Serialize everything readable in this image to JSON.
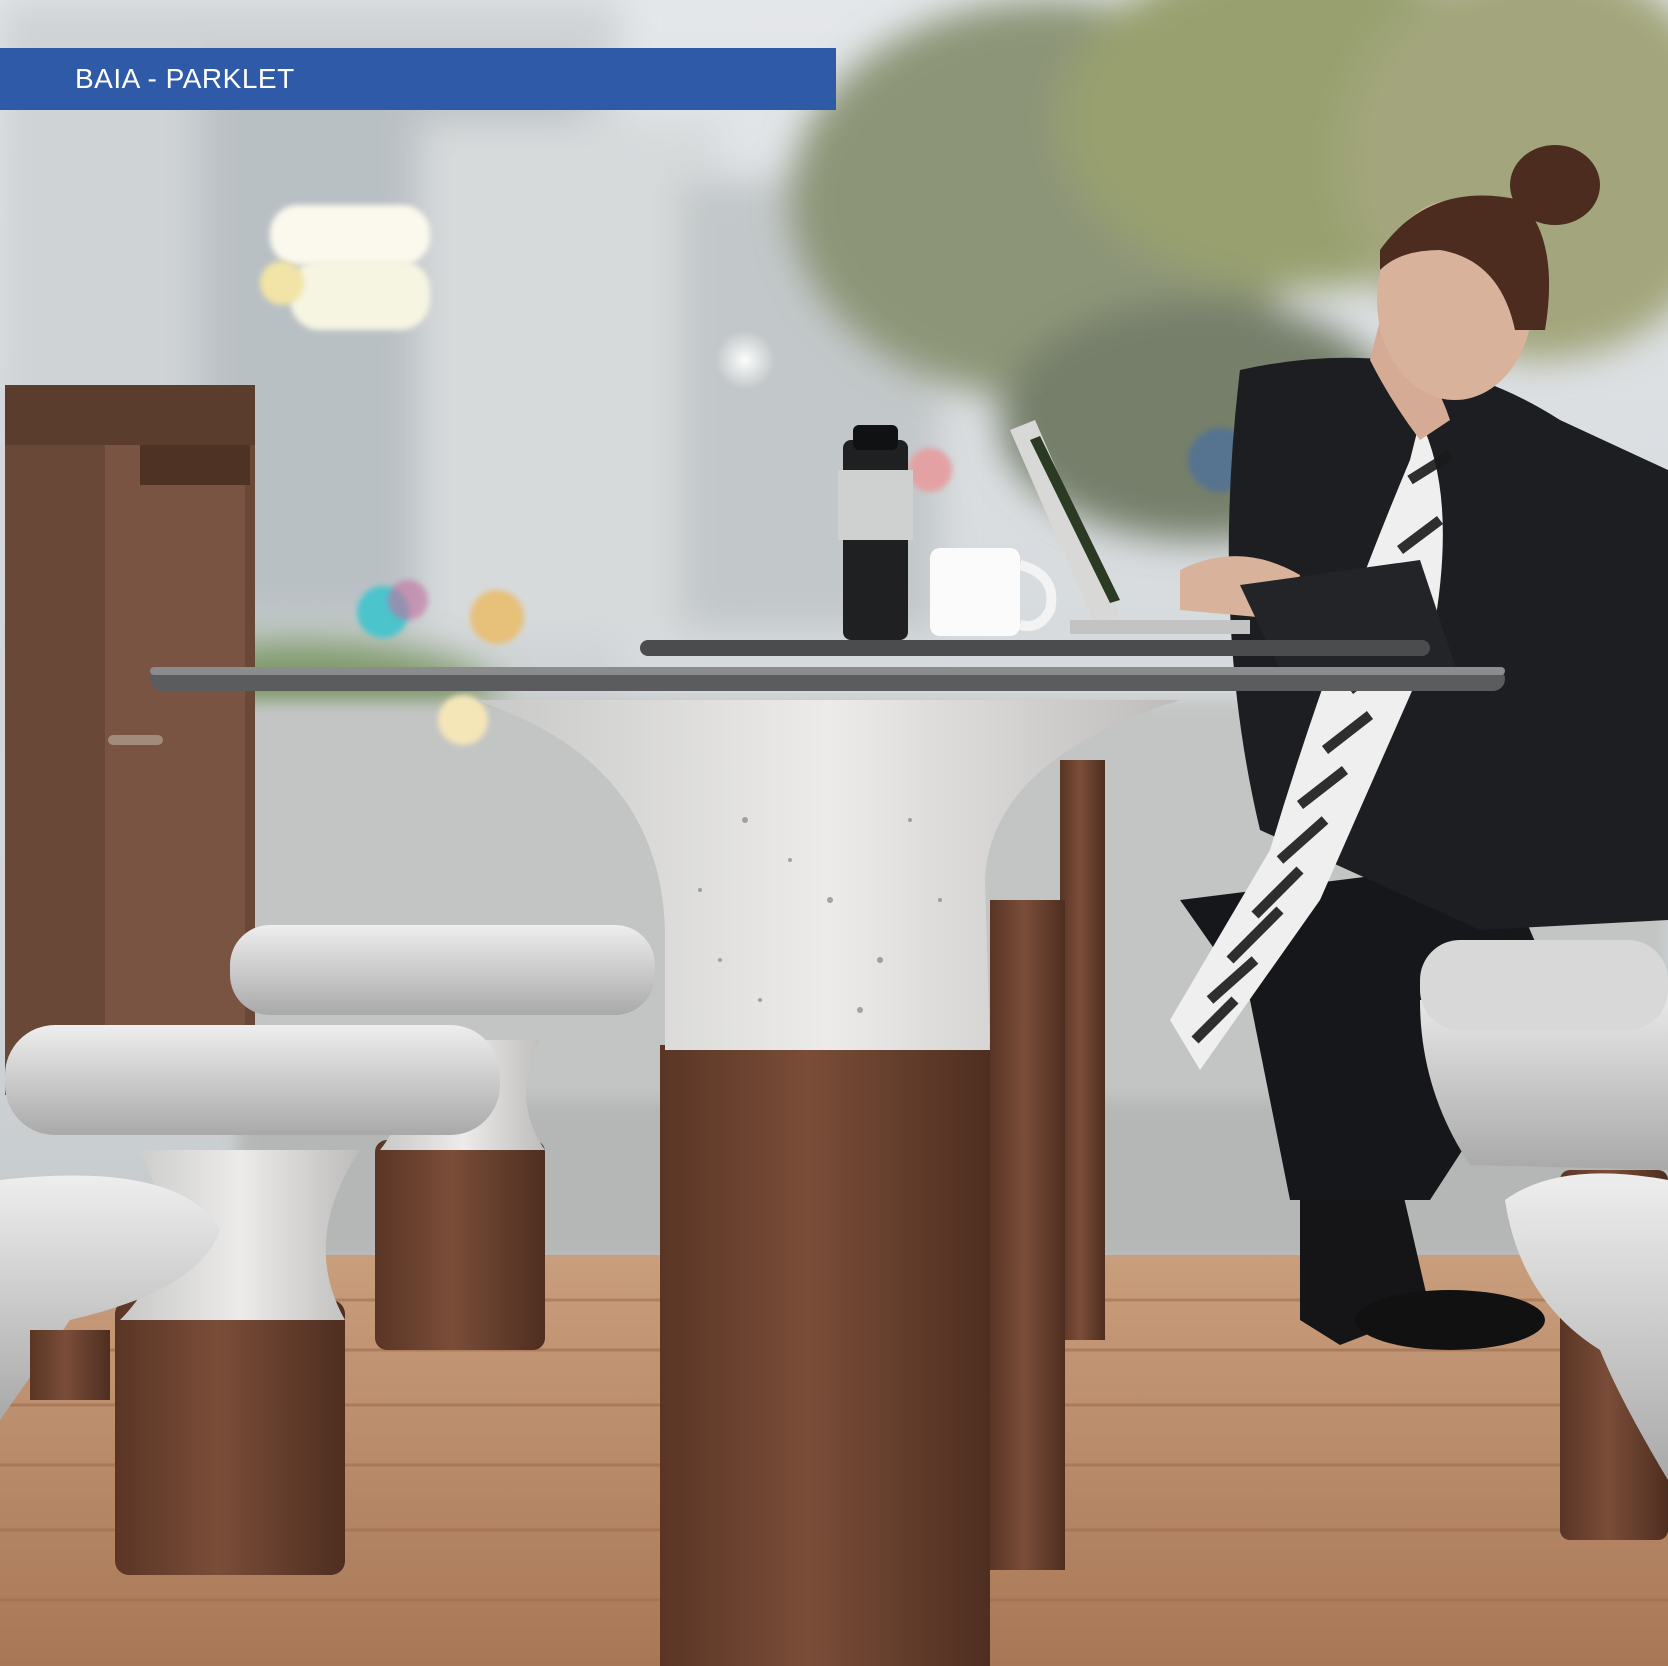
{
  "title": {
    "text": "BAIA - PARKLET",
    "background_color": "#2f5aa8",
    "text_color": "#ffffff"
  },
  "photo": {
    "palette": {
      "sky": "#dfe3e6",
      "building": "#c9ced2",
      "foliage": "#8e9a6c",
      "street": "#b9bcbc",
      "planter_brown": "#6a4837",
      "concrete": "#d9d9d8",
      "bronze_stem": "#6d4532",
      "table_top": "#595b5d",
      "deck_wood": "#b7896a",
      "jacket": "#1d1e21",
      "skin": "#d8b29b",
      "hair": "#4b2c1e"
    }
  }
}
